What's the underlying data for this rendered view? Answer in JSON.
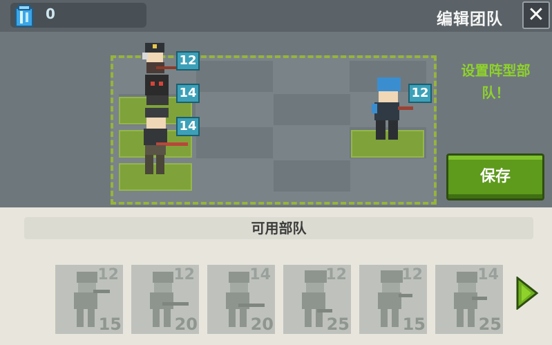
{
  "header": {
    "gem_count": "0",
    "title": "编辑团队",
    "close_label": "✕"
  },
  "board": {
    "hint": "设置阵型部队！",
    "save_label": "保存",
    "placed_units": [
      {
        "level": "12"
      },
      {
        "level": "14"
      },
      {
        "level": "14"
      },
      {
        "level": "12"
      }
    ]
  },
  "panel": {
    "title": "可用部队",
    "units": [
      {
        "level": "12",
        "cost": "15"
      },
      {
        "level": "12",
        "cost": "20"
      },
      {
        "level": "14",
        "cost": "20"
      },
      {
        "level": "12",
        "cost": "25"
      },
      {
        "level": "12",
        "cost": "15"
      },
      {
        "level": "14",
        "cost": "25"
      }
    ]
  },
  "colors": {
    "accent_green": "#5e9a1c",
    "hint_green": "#8fd22c",
    "level_badge": "#3ca0b8"
  }
}
